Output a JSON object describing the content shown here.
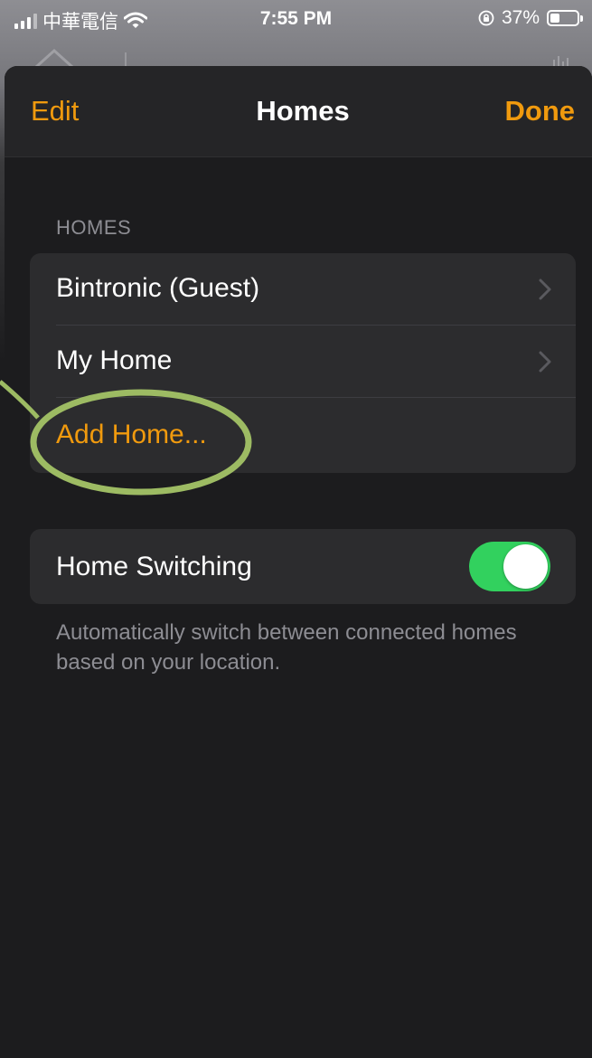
{
  "status_bar": {
    "carrier": "中華電信",
    "time": "7:55 PM",
    "battery_percent": "37%",
    "battery_level": 0.37
  },
  "nav": {
    "edit_label": "Edit",
    "title": "Homes",
    "done_label": "Done"
  },
  "homes_section": {
    "header": "HOMES",
    "items": [
      {
        "label": "Bintronic (Guest)"
      },
      {
        "label": "My Home"
      }
    ],
    "add_label": "Add Home..."
  },
  "home_switching": {
    "label": "Home Switching",
    "enabled": true,
    "footer": "Automatically switch between connected homes based on your location."
  },
  "colors": {
    "accent": "#f09a0e",
    "toggle_on": "#32d15e",
    "annotation_circle": "#9dbb63"
  },
  "icons": [
    "signal-icon",
    "wifi-icon",
    "orientation-lock-icon",
    "battery-icon",
    "chevron-right-icon",
    "home-icon"
  ]
}
